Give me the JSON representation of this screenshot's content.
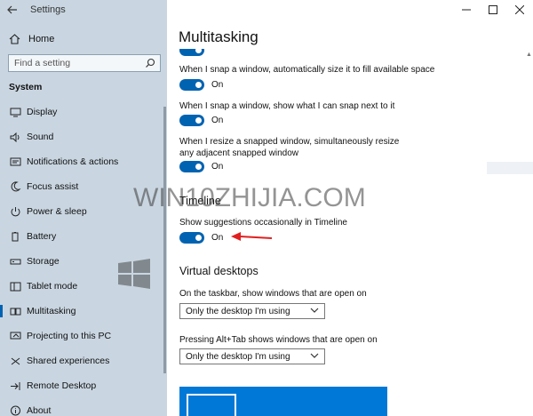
{
  "app": {
    "title": "Settings"
  },
  "sidebar": {
    "home_label": "Home",
    "search_placeholder": "Find a setting",
    "section_label": "System",
    "items": [
      {
        "label": "Display",
        "icon": "display-icon",
        "selected": false
      },
      {
        "label": "Sound",
        "icon": "sound-icon",
        "selected": false
      },
      {
        "label": "Notifications & actions",
        "icon": "notifications-icon",
        "selected": false
      },
      {
        "label": "Focus assist",
        "icon": "focus-assist-icon",
        "selected": false
      },
      {
        "label": "Power & sleep",
        "icon": "power-icon",
        "selected": false
      },
      {
        "label": "Battery",
        "icon": "battery-icon",
        "selected": false
      },
      {
        "label": "Storage",
        "icon": "storage-icon",
        "selected": false
      },
      {
        "label": "Tablet mode",
        "icon": "tablet-mode-icon",
        "selected": false
      },
      {
        "label": "Multitasking",
        "icon": "multitasking-icon",
        "selected": true
      },
      {
        "label": "Projecting to this PC",
        "icon": "projecting-icon",
        "selected": false
      },
      {
        "label": "Shared experiences",
        "icon": "shared-experiences-icon",
        "selected": false
      },
      {
        "label": "Remote Desktop",
        "icon": "remote-desktop-icon",
        "selected": false
      },
      {
        "label": "About",
        "icon": "about-icon",
        "selected": false
      }
    ]
  },
  "main": {
    "page_title": "Multitasking",
    "snap": {
      "setting1_label": "When I snap a window, automatically size it to fill available space",
      "setting1_state": "On",
      "setting2_label": "When I snap a window, show what I can snap next to it",
      "setting2_state": "On",
      "setting3_label": "When I resize a snapped window, simultaneously resize any adjacent snapped window",
      "setting3_state": "On"
    },
    "timeline": {
      "heading": "Timeline",
      "setting_label": "Show suggestions occasionally in Timeline",
      "setting_state": "On"
    },
    "virtual_desktops": {
      "heading": "Virtual desktops",
      "taskbar_label": "On the taskbar, show windows that are open on",
      "taskbar_value": "Only the desktop I'm using",
      "alttab_label": "Pressing Alt+Tab shows windows that are open on",
      "alttab_value": "Only the desktop I'm using"
    }
  },
  "watermark": {
    "text": "WIN10ZHIJIA.COM"
  },
  "colors": {
    "accent": "#0063b1",
    "sidebar_bg": "#c9d6e1",
    "preview_bg": "#0078d7",
    "arrow": "#e02020"
  }
}
